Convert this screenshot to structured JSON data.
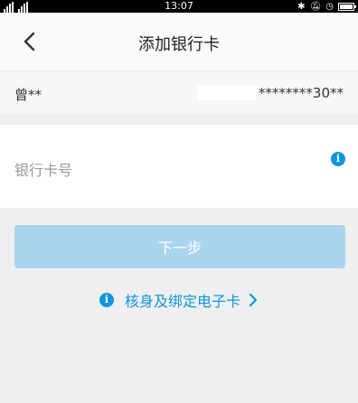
{
  "status_bar": {
    "carrier": "HD",
    "time": "13:07"
  },
  "header": {
    "title": "添加银行卡"
  },
  "account": {
    "name": "曾**",
    "card_suffix": "********30**"
  },
  "card_input": {
    "placeholder": "银行卡号",
    "value": ""
  },
  "next_button": {
    "label": "下一步"
  },
  "verify_link": {
    "label": "核身及绑定电子卡"
  },
  "colors": {
    "accent": "#1296db",
    "button_disabled": "#aad5ef"
  }
}
